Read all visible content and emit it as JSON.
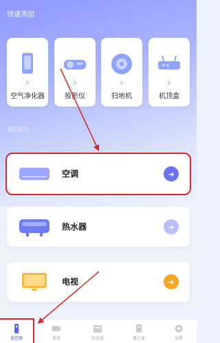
{
  "header": {
    "quick_add_title": "快速添加"
  },
  "quick_add": [
    {
      "label": "空气净化器",
      "count": "0",
      "icon": "air-purifier-icon"
    },
    {
      "label": "投影仪",
      "count": "0",
      "icon": "projector-icon"
    },
    {
      "label": "扫地机",
      "count": "0",
      "icon": "robot-vacuum-icon"
    },
    {
      "label": "机顶盒",
      "count": "0",
      "icon": "set-top-box-icon"
    }
  ],
  "section2": {
    "title": "我的遥控"
  },
  "devices": [
    {
      "label": "空调",
      "icon": "air-conditioner-icon",
      "button_icon": "arrow-right-icon",
      "button_color": "#6b73f0"
    },
    {
      "label": "热水器",
      "icon": "water-heater-icon",
      "button_icon": "arrow-right-icon",
      "button_color": "#b9bffb"
    },
    {
      "label": "电视",
      "icon": "tv-icon",
      "button_icon": "arrow-right-icon",
      "button_color": "#f5a623"
    }
  ],
  "arrow_glyph": "➜",
  "bottom_nav": [
    {
      "label": "遥控器",
      "icon": "remote-icon",
      "active": true
    },
    {
      "label": "发现",
      "icon": "discover-icon",
      "active": false
    },
    {
      "label": "纪念日",
      "icon": "calendar-icon",
      "active": false
    },
    {
      "label": "备忘录",
      "icon": "memo-icon",
      "active": false
    },
    {
      "label": "设置",
      "icon": "settings-icon",
      "active": false
    }
  ],
  "colors": {
    "accent": "#5866f2",
    "highlight": "#d9262c"
  }
}
